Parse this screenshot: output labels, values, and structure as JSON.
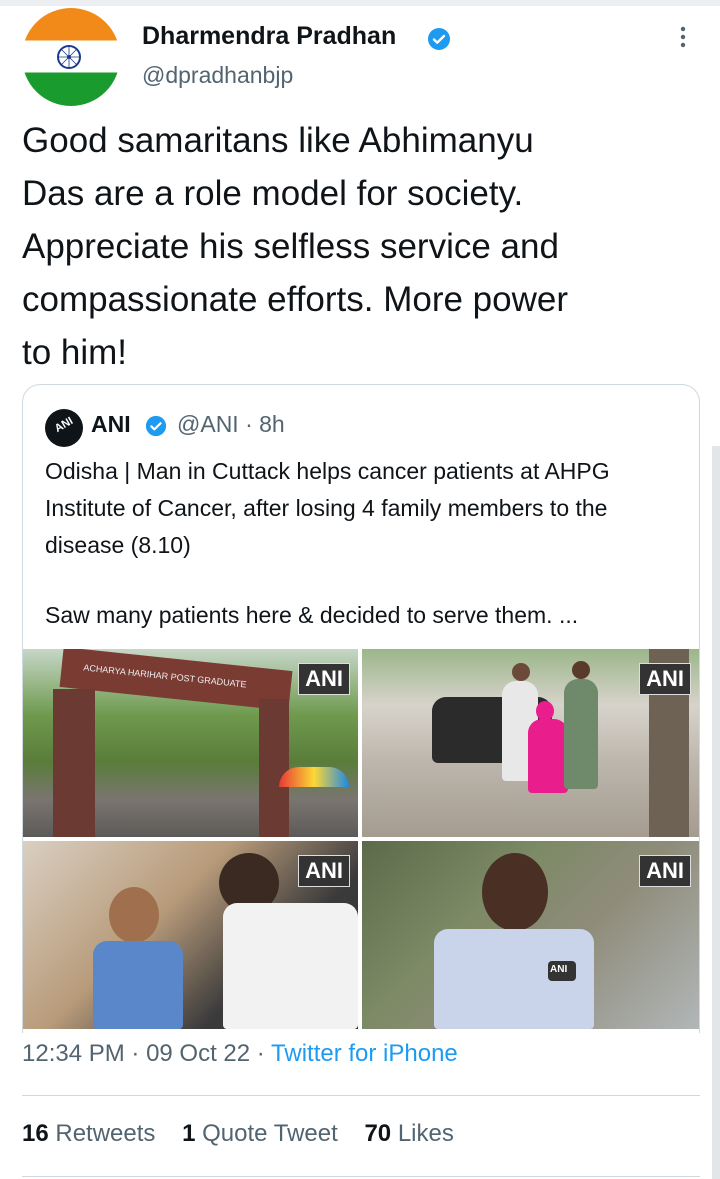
{
  "author": {
    "name": "Dharmendra Pradhan",
    "handle": "@dpradhanbjp",
    "avatar_icon": "india-flag-avatar",
    "verified_icon": "verified-badge-icon"
  },
  "tweet": {
    "text": "Good samaritans like Abhimanyu\nDas are a role model for society.\nAppreciate his selfless service and\ncompassionate efforts. More power\nto him!"
  },
  "quoted": {
    "name": "ANI",
    "handle_time": "@ANI · 8h",
    "text": "Odisha | Man in Cuttack helps cancer patients at AHPG Institute of Cancer, after losing 4 family members to the disease (8.10)",
    "text2": "Saw many patients here & decided to serve them. ...",
    "watermark": "ANI",
    "gate_sign": "ACHARYA HARIHAR POST GRADUATE"
  },
  "meta": {
    "time": "12:34 PM",
    "sep1": " · ",
    "date": "09 Oct 22",
    "sep2": " · ",
    "source": "Twitter for iPhone"
  },
  "stats": {
    "retweets_count": "16",
    "retweets_label": "Retweets",
    "quotes_count": "1",
    "quotes_label": "Quote Tweet",
    "likes_count": "70",
    "likes_label": "Likes"
  },
  "colors": {
    "accent": "#1d9bf0",
    "text": "#0f1419",
    "secondary": "#536471",
    "border": "#cfd9de"
  }
}
